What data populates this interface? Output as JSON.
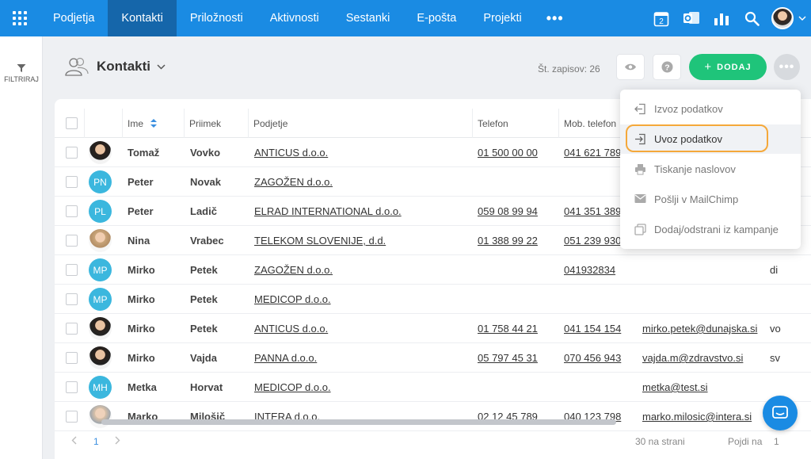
{
  "nav": {
    "items": [
      {
        "label": "Podjetja",
        "active": false
      },
      {
        "label": "Kontakti",
        "active": true
      },
      {
        "label": "Priložnosti",
        "active": false
      },
      {
        "label": "Aktivnosti",
        "active": false
      },
      {
        "label": "Sestanki",
        "active": false
      },
      {
        "label": "E-pošta",
        "active": false
      },
      {
        "label": "Projekti",
        "active": false
      }
    ],
    "more": "•••",
    "calendar_day": "2",
    "icons": [
      "calendar-icon",
      "outlook-icon",
      "reports-icon",
      "search-icon",
      "user-avatar"
    ]
  },
  "sidebar": {
    "filter_label": "FILTRIRAJ"
  },
  "header": {
    "title": "Kontakti",
    "records_label": "Št. zapisov: 26",
    "add_label": "DODAJ",
    "add_prefix": "+",
    "more_label": "•••"
  },
  "table": {
    "columns": [
      "Ime",
      "Priimek",
      "Podjetje",
      "Telefon",
      "Mob. telefon"
    ],
    "rows": [
      {
        "avatar": "photo-m",
        "initials": "",
        "first": "Tomaž",
        "last": "Vovko",
        "company": "ANTICUS d.o.o.",
        "phone": "01 500 00 00",
        "mobile": "041 621 789",
        "email": "",
        "extra": ""
      },
      {
        "avatar": "init",
        "initials": "PN",
        "first": "Peter",
        "last": "Novak",
        "company": "ZAGOŽEN d.o.o.",
        "phone": "",
        "mobile": "",
        "email": "",
        "extra": ""
      },
      {
        "avatar": "init",
        "initials": "PL",
        "first": "Peter",
        "last": "Ladič",
        "company": "ELRAD INTERNATIONAL d.o.o.",
        "phone": "059 08 99 94",
        "mobile": "041 351 389",
        "email": "",
        "extra": ""
      },
      {
        "avatar": "photo-f",
        "initials": "",
        "first": "Nina",
        "last": "Vrabec",
        "company": "TELEKOM SLOVENIJE, d.d.",
        "phone": "01 388 99 22",
        "mobile": "051 239 930",
        "email": "",
        "extra": ""
      },
      {
        "avatar": "init",
        "initials": "MP",
        "first": "Mirko",
        "last": "Petek",
        "company": "ZAGOŽEN d.o.o.",
        "phone": "",
        "mobile": "041932834",
        "email": "",
        "extra": "di"
      },
      {
        "avatar": "init",
        "initials": "MP",
        "first": "Mirko",
        "last": "Petek",
        "company": "MEDICOP d.o.o.",
        "phone": "",
        "mobile": "",
        "email": "",
        "extra": ""
      },
      {
        "avatar": "photo-m",
        "initials": "",
        "first": "Mirko",
        "last": "Petek",
        "company": "ANTICUS d.o.o.",
        "phone": "01 758 44 21",
        "mobile": "041 154 154",
        "email": "mirko.petek@dunajska.si",
        "extra": "vo"
      },
      {
        "avatar": "photo-m",
        "initials": "",
        "first": "Mirko",
        "last": "Vajda",
        "company": "PANNA d.o.o.",
        "phone": "05 797 45 31",
        "mobile": "070 456 943",
        "email": "vajda.m@zdravstvo.si",
        "extra": "sv"
      },
      {
        "avatar": "init",
        "initials": "MH",
        "first": "Metka",
        "last": "Horvat",
        "company": "MEDICOP d.o.o.",
        "phone": "",
        "mobile": "",
        "email": "metka@test.si",
        "extra": ""
      },
      {
        "avatar": "photo-o",
        "initials": "",
        "first": "Marko",
        "last": "Milošič",
        "company": "INTERA d.o.o.",
        "phone": "02 12 45 789",
        "mobile": "040 123 798",
        "email": "marko.milosic@intera.si",
        "extra": ""
      }
    ]
  },
  "footer": {
    "page": "1",
    "per_page": "30 na strani",
    "goto_label": "Pojdi na",
    "goto_value": "1"
  },
  "menu": {
    "items": [
      {
        "label": "Izvoz podatkov",
        "icon": "export-icon",
        "highlighted": false
      },
      {
        "label": "Uvoz podatkov",
        "icon": "import-icon",
        "highlighted": true
      },
      {
        "label": "Tiskanje naslovov",
        "icon": "print-icon",
        "highlighted": false
      },
      {
        "label": "Pošlji v MailChimp",
        "icon": "mail-icon",
        "highlighted": false
      },
      {
        "label": "Dodaj/odstrani iz kampanje",
        "icon": "campaign-icon",
        "highlighted": false
      }
    ]
  },
  "colors": {
    "nav_bg": "#1a8be3",
    "nav_active": "#1566aa",
    "add_button": "#1fc47a",
    "avatar_initials": "#3bb7de",
    "highlight_ring": "#f5a83a"
  }
}
